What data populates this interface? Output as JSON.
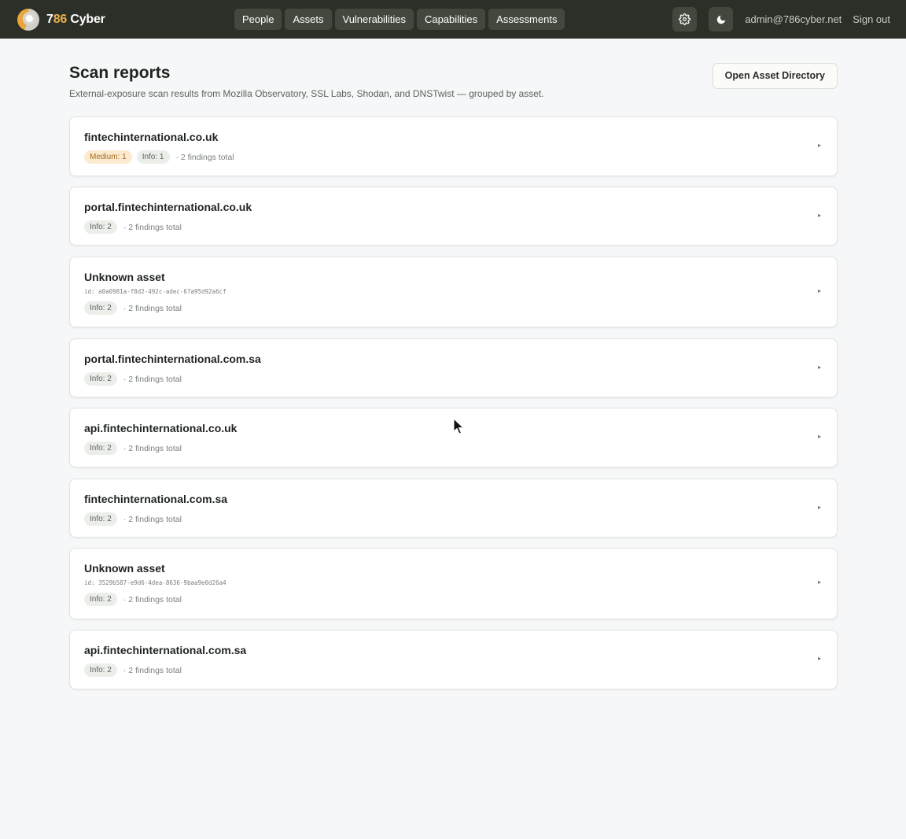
{
  "brand": {
    "name_prefix": "7",
    "name_accent": "86",
    "name_suffix": " Cyber"
  },
  "nav": {
    "items": [
      "People",
      "Assets",
      "Vulnerabilities",
      "Capabilities",
      "Assessments"
    ]
  },
  "header_right": {
    "settings_icon": "gear-icon",
    "theme_icon": "moon-icon",
    "user_email": "admin@786cyber.net",
    "sign_out": "Sign out"
  },
  "page": {
    "title": "Scan reports",
    "subtitle": "External-exposure scan results from Mozilla Observatory, SSL Labs, Shodan, and DNSTwist — grouped by asset.",
    "open_directory_label": "Open Asset Directory"
  },
  "assets": [
    {
      "name": "fintechinternational.co.uk",
      "id": "",
      "badges": [
        {
          "label": "Medium: 1",
          "kind": "medium"
        },
        {
          "label": "Info: 1",
          "kind": "info"
        }
      ],
      "total": "· 2 findings total"
    },
    {
      "name": "portal.fintechinternational.co.uk",
      "id": "",
      "badges": [
        {
          "label": "Info: 2",
          "kind": "info"
        }
      ],
      "total": "· 2 findings total"
    },
    {
      "name": "Unknown asset",
      "id": "id: a0a0981a-f8d2-492c-adec-67a95d92a6cf",
      "badges": [
        {
          "label": "Info: 2",
          "kind": "info"
        }
      ],
      "total": "· 2 findings total"
    },
    {
      "name": "portal.fintechinternational.com.sa",
      "id": "",
      "badges": [
        {
          "label": "Info: 2",
          "kind": "info"
        }
      ],
      "total": "· 2 findings total"
    },
    {
      "name": "api.fintechinternational.co.uk",
      "id": "",
      "badges": [
        {
          "label": "Info: 2",
          "kind": "info"
        }
      ],
      "total": "· 2 findings total"
    },
    {
      "name": "fintechinternational.com.sa",
      "id": "",
      "badges": [
        {
          "label": "Info: 2",
          "kind": "info"
        }
      ],
      "total": "· 2 findings total"
    },
    {
      "name": "Unknown asset",
      "id": "id: 3529b587-e9d6-4dea-8636-9baa9e0d26a4",
      "badges": [
        {
          "label": "Info: 2",
          "kind": "info"
        }
      ],
      "total": "· 2 findings total"
    },
    {
      "name": "api.fintechinternational.com.sa",
      "id": "",
      "badges": [
        {
          "label": "Info: 2",
          "kind": "info"
        }
      ],
      "total": "· 2 findings total"
    }
  ],
  "expand_icon": "caret-right-icon"
}
